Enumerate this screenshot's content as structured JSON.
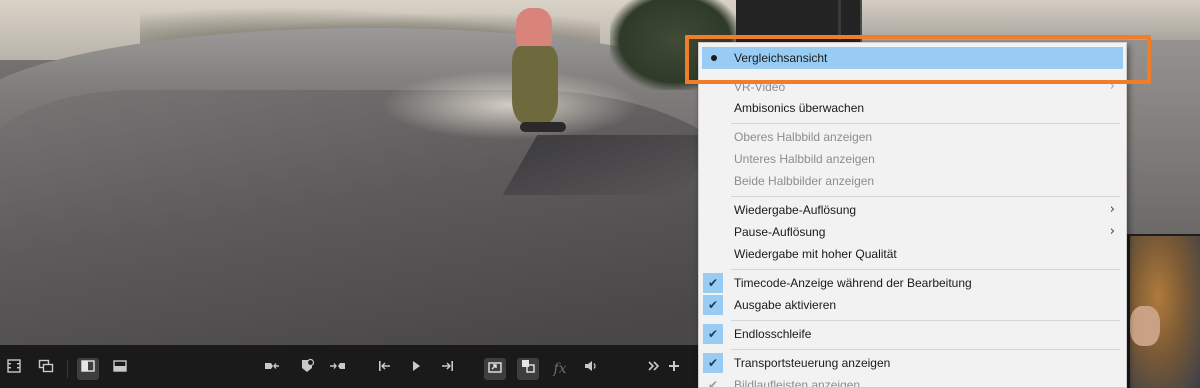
{
  "menu": {
    "items": [
      {
        "label": "Vergleichsansicht",
        "state": "radio",
        "highlight": true
      },
      {
        "label": "VR-Video",
        "disabled": true,
        "submenu": true
      },
      {
        "label": "Ambisonics überwachen"
      },
      {
        "label": "Oberes Halbbild anzeigen",
        "disabled": true
      },
      {
        "label": "Unteres Halbbild anzeigen",
        "disabled": true
      },
      {
        "label": "Beide Halbbilder anzeigen",
        "disabled": true
      },
      {
        "label": "Wiedergabe-Auflösung",
        "submenu": true
      },
      {
        "label": "Pause-Auflösung",
        "submenu": true
      },
      {
        "label": "Wiedergabe mit hoher Qualität"
      },
      {
        "label": "Timecode-Anzeige während der Bearbeitung",
        "checked": true
      },
      {
        "label": "Ausgabe aktivieren",
        "checked": true
      },
      {
        "label": "Endlosschleife",
        "checked": true
      },
      {
        "label": "Transportsteuerung anzeigen",
        "checked": true
      },
      {
        "label": "Bildlaufleisten anzeigen",
        "checked": true,
        "disabled": true
      }
    ],
    "check_glyph": "✔",
    "submenu_glyph": "›"
  },
  "toolbar": {
    "icons": [
      "filmstrip-icon",
      "multi-camera-icon",
      "side-by-side-view-icon",
      "split-view-icon",
      "go-to-in-icon",
      "add-marker-icon",
      "go-to-out-icon",
      "step-back-icon",
      "play-icon",
      "step-forward-icon",
      "export-frame-icon",
      "comparison-icon",
      "fx-icon",
      "volume-icon",
      "more-icon",
      "add-icon"
    ],
    "fx_label": "fx"
  },
  "colors": {
    "menu_bg": "#f2f2f2",
    "menu_highlight": "#99ccf3",
    "annotation": "#ef7d2a",
    "toolbar_bg": "#1a1a1a"
  }
}
